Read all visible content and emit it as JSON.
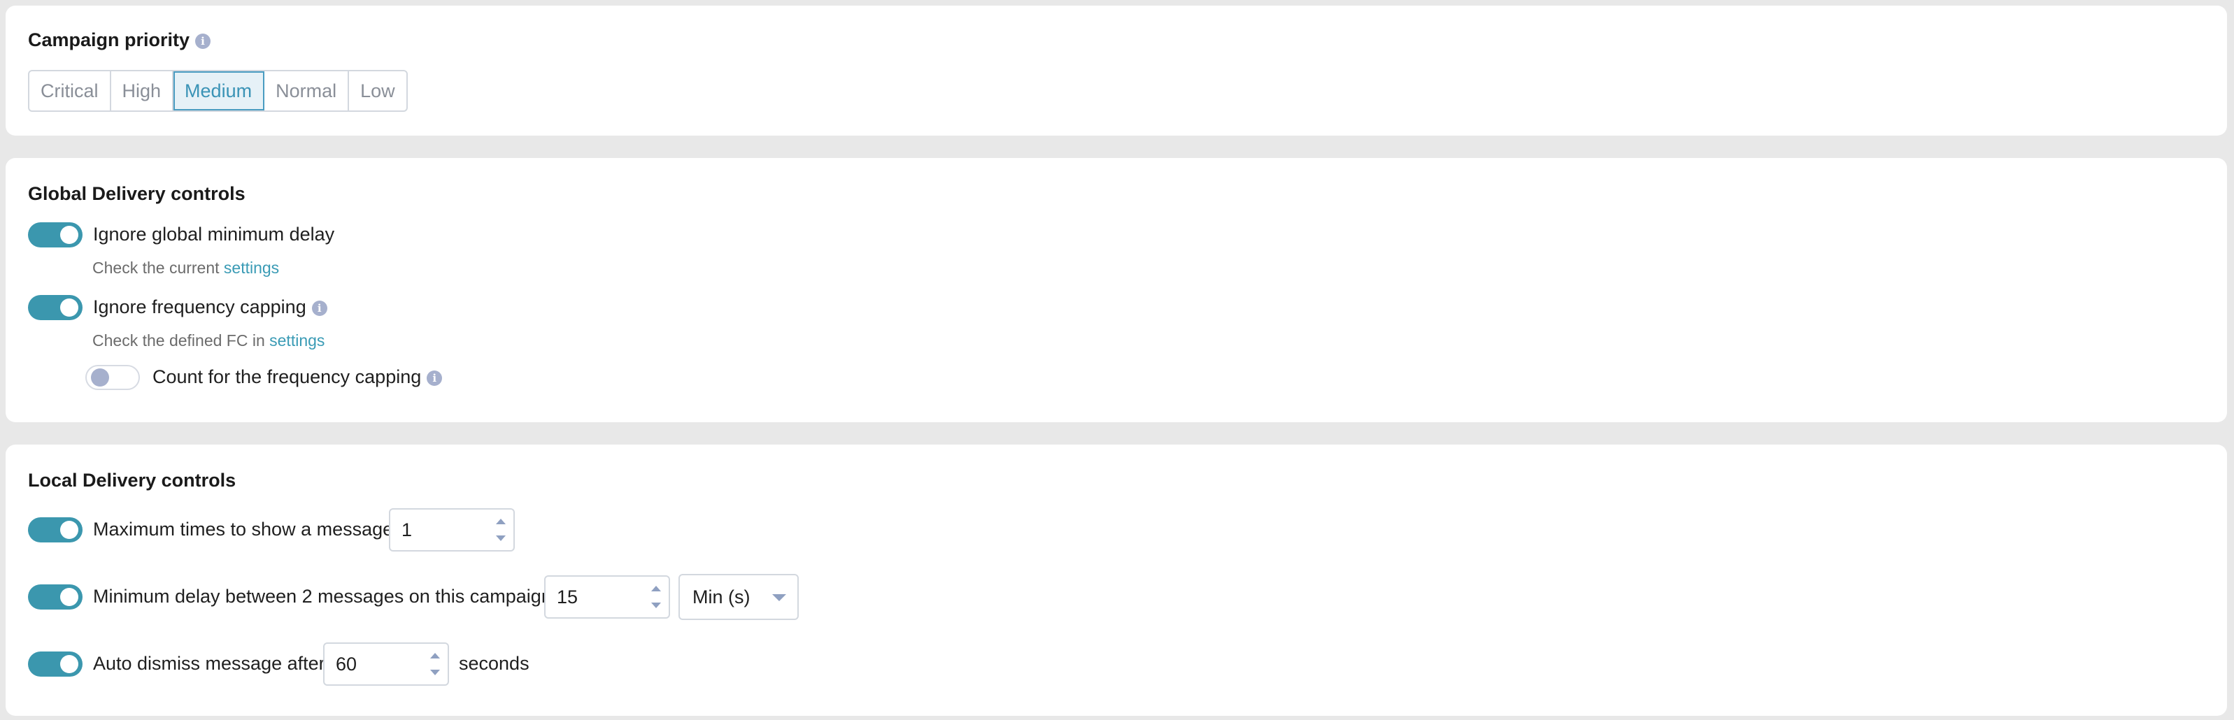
{
  "campaign_priority": {
    "title": "Campaign priority",
    "info_icon": "info-icon",
    "options": [
      "Critical",
      "High",
      "Medium",
      "Normal",
      "Low"
    ],
    "selected": "Medium"
  },
  "global_delivery": {
    "title": "Global Delivery controls",
    "ignore_min_delay": {
      "label": "Ignore global minimum delay",
      "enabled": true,
      "hint_text": "Check the current",
      "hint_link": "settings"
    },
    "ignore_frequency_capping": {
      "label": "Ignore frequency capping",
      "enabled": true,
      "hint_text": "Check the defined FC in",
      "hint_link": "settings"
    },
    "count_frequency_capping": {
      "label": "Count for the frequency capping",
      "enabled": false
    }
  },
  "local_delivery": {
    "title": "Local Delivery controls",
    "max_times": {
      "label": "Maximum times to show a message",
      "enabled": true,
      "value": "1"
    },
    "min_delay": {
      "label": "Minimum delay between 2 messages on this campaign",
      "enabled": true,
      "value": "15",
      "unit": "Min (s)"
    },
    "auto_dismiss": {
      "label": "Auto dismiss message after",
      "enabled": true,
      "value": "60",
      "suffix": "seconds"
    }
  },
  "colors": {
    "accent": "#3b97ae",
    "link": "#3a9bb5",
    "selected_segment_bg": "#e6f1f7",
    "info_icon": "#a6b0cd"
  }
}
